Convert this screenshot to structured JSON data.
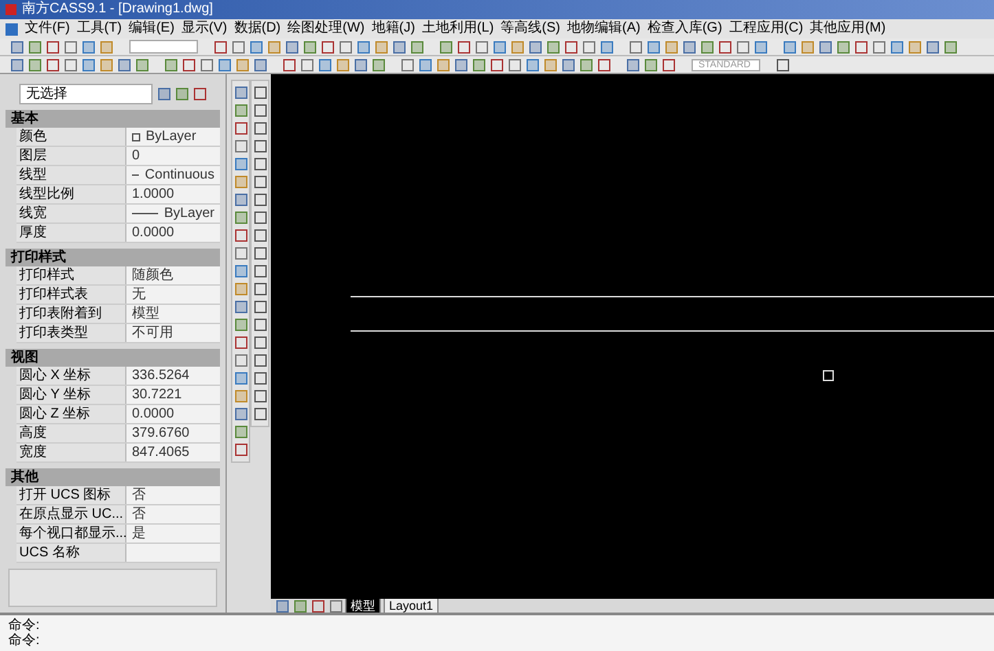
{
  "window": {
    "title": "南方CASS9.1 - [Drawing1.dwg]"
  },
  "menu": [
    "文件(F)",
    "工具(T)",
    "编辑(E)",
    "显示(V)",
    "数据(D)",
    "绘图处理(W)",
    "地籍(J)",
    "土地利用(L)",
    "等高线(S)",
    "地物编辑(A)",
    "检查入库(G)",
    "工程应用(C)",
    "其他应用(M)"
  ],
  "toolbar": {
    "text_style": "STANDARD"
  },
  "properties": {
    "selection": "无选择",
    "sections": [
      {
        "title": "基本",
        "rows": [
          {
            "label": "颜色",
            "value": "ByLayer",
            "kind": "color"
          },
          {
            "label": "图层",
            "value": "0",
            "kind": "text"
          },
          {
            "label": "线型",
            "value": "Continuous",
            "kind": "line"
          },
          {
            "label": "线型比例",
            "value": "1.0000",
            "kind": "text"
          },
          {
            "label": "线宽",
            "value": "ByLayer",
            "kind": "line"
          },
          {
            "label": "厚度",
            "value": "0.0000",
            "kind": "text"
          }
        ]
      },
      {
        "title": "打印样式",
        "rows": [
          {
            "label": "打印样式",
            "value": "随颜色",
            "kind": "text"
          },
          {
            "label": "打印样式表",
            "value": "无",
            "kind": "text"
          },
          {
            "label": "打印表附着到",
            "value": "模型",
            "kind": "text"
          },
          {
            "label": "打印表类型",
            "value": "不可用",
            "kind": "text"
          }
        ]
      },
      {
        "title": "视图",
        "rows": [
          {
            "label": "圆心 X 坐标",
            "value": "336.5264",
            "kind": "text"
          },
          {
            "label": "圆心 Y 坐标",
            "value": "30.7221",
            "kind": "text"
          },
          {
            "label": "圆心 Z 坐标",
            "value": "0.0000",
            "kind": "text"
          },
          {
            "label": "高度",
            "value": "379.6760",
            "kind": "text"
          },
          {
            "label": "宽度",
            "value": "847.4065",
            "kind": "text"
          }
        ]
      },
      {
        "title": "其他",
        "rows": [
          {
            "label": "打开 UCS 图标",
            "value": "否",
            "kind": "text"
          },
          {
            "label": "在原点显示 UC...",
            "value": "否",
            "kind": "text"
          },
          {
            "label": "每个视口都显示...",
            "value": "是",
            "kind": "text"
          },
          {
            "label": "UCS 名称",
            "kind": "text"
          }
        ]
      }
    ]
  },
  "layout_tabs": [
    {
      "label": "模型",
      "selected": true
    },
    {
      "label": "Layout1",
      "selected": false
    }
  ],
  "command_lines": [
    "命令:",
    "命令:"
  ]
}
